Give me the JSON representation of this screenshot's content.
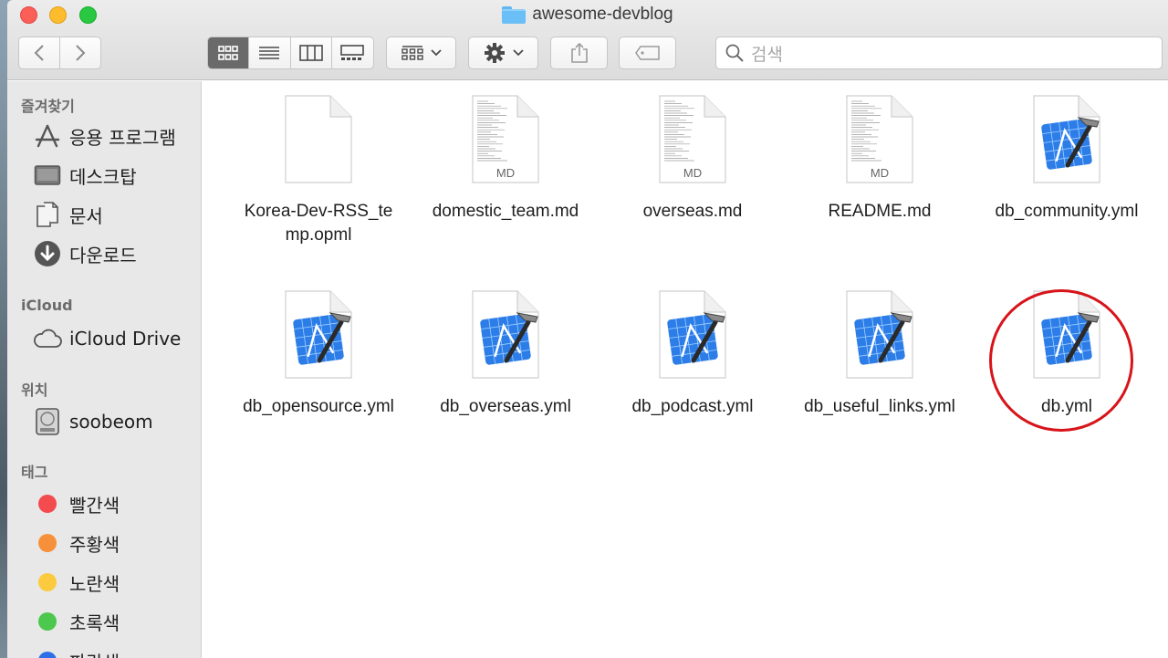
{
  "window": {
    "title": "awesome-devblog"
  },
  "toolbar": {
    "back_icon": "chevron-left-icon",
    "forward_icon": "chevron-right-icon",
    "views": [
      "icon-view-icon",
      "list-view-icon",
      "column-view-icon",
      "gallery-view-icon"
    ],
    "active_view": 0,
    "arrange_icon": "group-icon",
    "action_icon": "gear-icon",
    "share_icon": "share-icon",
    "tag_icon": "tag-icon"
  },
  "search": {
    "placeholder": "검색"
  },
  "sidebar": {
    "favorites_header": "즐겨찾기",
    "favorites": [
      {
        "label": "응용 프로그램",
        "icon": "applications-icon"
      },
      {
        "label": "데스크탑",
        "icon": "desktop-icon"
      },
      {
        "label": "문서",
        "icon": "documents-icon"
      },
      {
        "label": "다운로드",
        "icon": "downloads-icon"
      }
    ],
    "icloud_header": "iCloud",
    "icloud": [
      {
        "label": "iCloud Drive",
        "icon": "cloud-icon"
      }
    ],
    "locations_header": "위치",
    "locations": [
      {
        "label": "soobeom",
        "icon": "hard-drive-icon"
      }
    ],
    "tags_header": "태그",
    "tags": [
      {
        "label": "빨간색",
        "color": "#f34b4e"
      },
      {
        "label": "주황색",
        "color": "#f7903a"
      },
      {
        "label": "노란색",
        "color": "#fbca3f"
      },
      {
        "label": "초록색",
        "color": "#4bc84d"
      },
      {
        "label": "파란색",
        "color": "#2d6fe6"
      }
    ]
  },
  "files": [
    {
      "name": "Korea-Dev-RSS_temp.opml",
      "kind": "blank"
    },
    {
      "name": "domestic_team.md",
      "kind": "md",
      "badge": "MD"
    },
    {
      "name": "overseas.md",
      "kind": "md",
      "badge": "MD"
    },
    {
      "name": "README.md",
      "kind": "md",
      "badge": "MD"
    },
    {
      "name": "db_community.yml",
      "kind": "xcode"
    },
    {
      "name": "db_opensource.yml",
      "kind": "xcode"
    },
    {
      "name": "db_overseas.yml",
      "kind": "xcode"
    },
    {
      "name": "db_podcast.yml",
      "kind": "xcode"
    },
    {
      "name": "db_useful_links.yml",
      "kind": "xcode"
    },
    {
      "name": "db.yml",
      "kind": "xcode",
      "highlighted": true
    }
  ],
  "highlight_color": "#d7141a"
}
